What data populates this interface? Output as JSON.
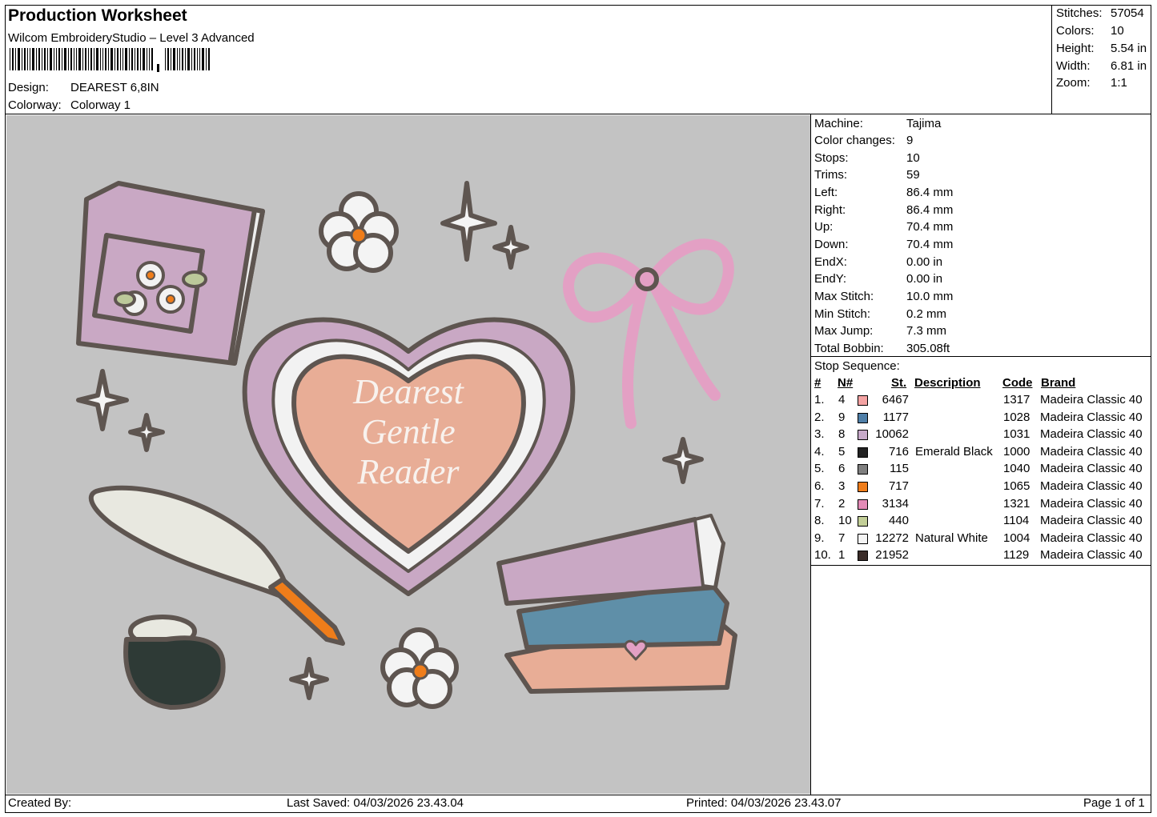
{
  "header": {
    "title": "Production Worksheet",
    "software": "Wilcom EmbroideryStudio – Level 3 Advanced",
    "design_label": "Design:",
    "design_value": "DEAREST 6,8IN",
    "colorway_label": "Colorway:",
    "colorway_value": "Colorway 1"
  },
  "stats": [
    {
      "label": "Stitches:",
      "value": "57054"
    },
    {
      "label": "Colors:",
      "value": "10"
    },
    {
      "label": "Height:",
      "value": "5.54 in"
    },
    {
      "label": "Width:",
      "value": "6.81 in"
    },
    {
      "label": "Zoom:",
      "value": "1:1"
    }
  ],
  "machine_info": [
    {
      "label": "Machine:",
      "value": "Tajima"
    },
    {
      "label": "Color changes:",
      "value": "9"
    },
    {
      "label": "Stops:",
      "value": "10"
    },
    {
      "label": "Trims:",
      "value": "59"
    },
    {
      "label": "Left:",
      "value": "86.4 mm"
    },
    {
      "label": "Right:",
      "value": "86.4 mm"
    },
    {
      "label": "Up:",
      "value": "70.4 mm"
    },
    {
      "label": "Down:",
      "value": "70.4 mm"
    },
    {
      "label": "EndX:",
      "value": "0.00 in"
    },
    {
      "label": "EndY:",
      "value": "0.00 in"
    },
    {
      "label": "Max Stitch:",
      "value": "10.0 mm"
    },
    {
      "label": "Min Stitch:",
      "value": "0.2 mm"
    },
    {
      "label": "Max Jump:",
      "value": "7.3 mm"
    },
    {
      "label": "Total Bobbin:",
      "value": "305.08ft"
    }
  ],
  "stop_sequence": {
    "title": "Stop Sequence:",
    "headers": {
      "idx": "#",
      "needle": "N#",
      "stitches": "St.",
      "description": "Description",
      "code": "Code",
      "brand": "Brand"
    },
    "rows": [
      {
        "idx": "1.",
        "needle": "4",
        "color": "#f4a3a3",
        "stitches": "6467",
        "description": "",
        "code": "1317",
        "brand": "Madeira Classic 40"
      },
      {
        "idx": "2.",
        "needle": "9",
        "color": "#4f7fa8",
        "stitches": "1177",
        "description": "",
        "code": "1028",
        "brand": "Madeira Classic 40"
      },
      {
        "idx": "3.",
        "needle": "8",
        "color": "#c7a9c9",
        "stitches": "10062",
        "description": "",
        "code": "1031",
        "brand": "Madeira Classic 40"
      },
      {
        "idx": "4.",
        "needle": "5",
        "color": "#222222",
        "stitches": "716",
        "description": "Emerald Black",
        "code": "1000",
        "brand": "Madeira Classic 40"
      },
      {
        "idx": "5.",
        "needle": "6",
        "color": "#7f7f7f",
        "stitches": "115",
        "description": "",
        "code": "1040",
        "brand": "Madeira Classic 40"
      },
      {
        "idx": "6.",
        "needle": "3",
        "color": "#ef7d1a",
        "stitches": "717",
        "description": "",
        "code": "1065",
        "brand": "Madeira Classic 40"
      },
      {
        "idx": "7.",
        "needle": "2",
        "color": "#e38bb7",
        "stitches": "3134",
        "description": "",
        "code": "1321",
        "brand": "Madeira Classic 40"
      },
      {
        "idx": "8.",
        "needle": "10",
        "color": "#c3cf98",
        "stitches": "440",
        "description": "",
        "code": "1104",
        "brand": "Madeira Classic 40"
      },
      {
        "idx": "9.",
        "needle": "7",
        "color": "#f4f4f4",
        "stitches": "12272",
        "description": "Natural White",
        "code": "1004",
        "brand": "Madeira Classic 40"
      },
      {
        "idx": "10.",
        "needle": "1",
        "color": "#3a2c28",
        "stitches": "21952",
        "description": "",
        "code": "1129",
        "brand": "Madeira Classic 40"
      }
    ]
  },
  "design_text": [
    "Dearest",
    "Gentle",
    "Reader"
  ],
  "footer": {
    "created_by": "Created By:",
    "last_saved": "Last Saved: 04/03/2026 23.43.04",
    "printed": "Printed: 04/03/2026 23.43.07",
    "page": "Page 1 of 1"
  }
}
